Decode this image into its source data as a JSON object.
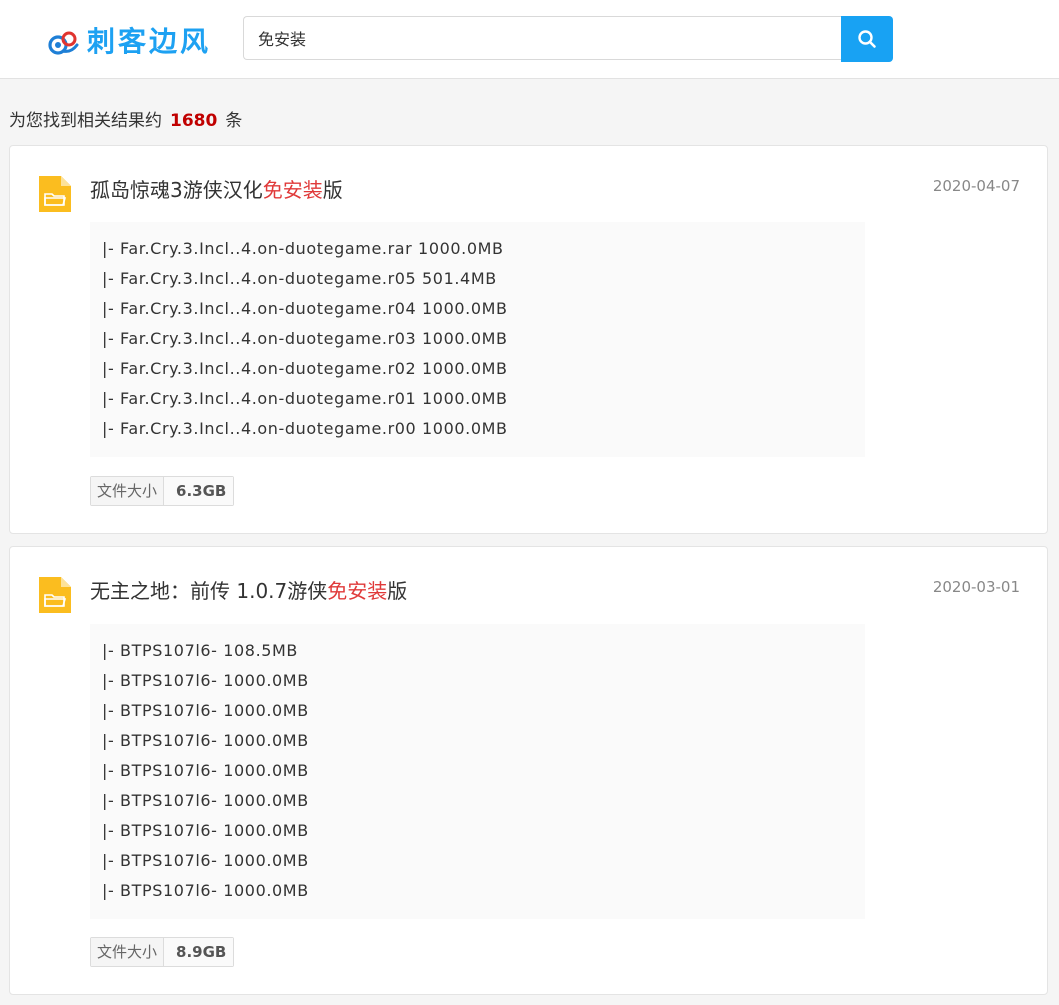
{
  "header": {
    "logo_text": "刺客边风",
    "search": {
      "value": "免安装",
      "placeholder": ""
    },
    "search_button_icon": "search-icon",
    "accent_color": "#18a2f3"
  },
  "summary": {
    "prefix": "为您找到相关结果约",
    "count": "1680",
    "suffix": "条"
  },
  "results": [
    {
      "icon": "folder-icon",
      "title_before": "孤岛惊魂3游侠汉化",
      "title_highlight": "免安装",
      "title_after": "版",
      "date": "2020-04-07",
      "files": [
        "|- Far.Cry.3.Incl..4.on-duotegame.rar 1000.0MB",
        "|- Far.Cry.3.Incl..4.on-duotegame.r05 501.4MB",
        "|- Far.Cry.3.Incl..4.on-duotegame.r04 1000.0MB",
        "|- Far.Cry.3.Incl..4.on-duotegame.r03 1000.0MB",
        "|- Far.Cry.3.Incl..4.on-duotegame.r02 1000.0MB",
        "|- Far.Cry.3.Incl..4.on-duotegame.r01 1000.0MB",
        "|- Far.Cry.3.Incl..4.on-duotegame.r00 1000.0MB"
      ],
      "size_label": "文件大小",
      "size_value": "6.3GB"
    },
    {
      "icon": "folder-icon",
      "title_before": "无主之地：前传 1.0.7游侠",
      "title_highlight": "免安装",
      "title_after": "版",
      "date": "2020-03-01",
      "files": [
        "|- BTPS107l6- 108.5MB",
        "|- BTPS107l6- 1000.0MB",
        "|- BTPS107l6- 1000.0MB",
        "|- BTPS107l6- 1000.0MB",
        "|- BTPS107l6- 1000.0MB",
        "|- BTPS107l6- 1000.0MB",
        "|- BTPS107l6- 1000.0MB",
        "|- BTPS107l6- 1000.0MB",
        "|- BTPS107l6- 1000.0MB"
      ],
      "size_label": "文件大小",
      "size_value": "8.9GB"
    }
  ]
}
